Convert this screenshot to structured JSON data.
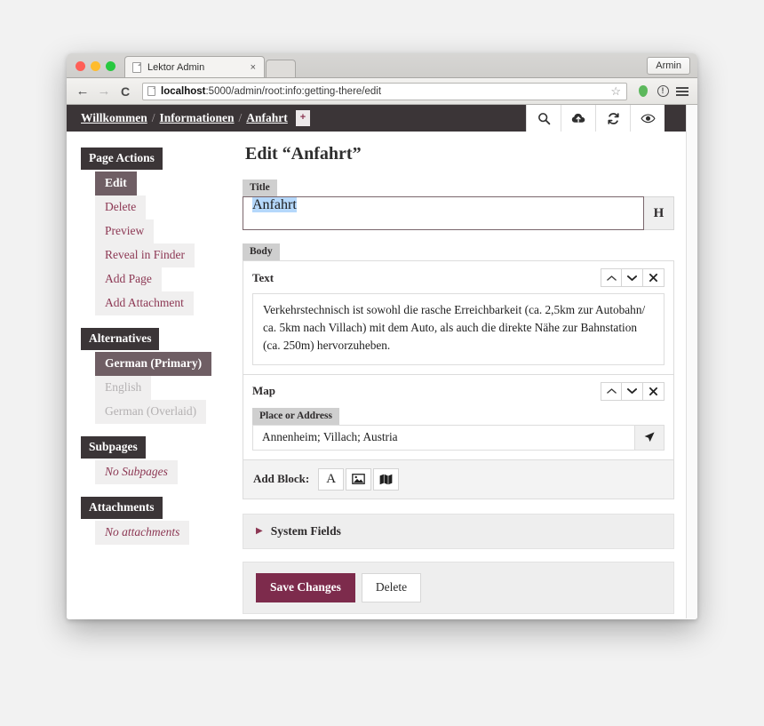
{
  "browser": {
    "tab_title": "Lektor Admin",
    "tab_close": "×",
    "profile": "Armin",
    "back_icon": "←",
    "forward_icon": "→",
    "reload_icon": "C",
    "url_prefix": "localhost",
    "url_rest": ":5000/admin/root:info:getting-there/edit",
    "star_icon": "☆"
  },
  "nav": {
    "breadcrumb": [
      {
        "label": "Willkommen"
      },
      {
        "label": "Informationen"
      },
      {
        "label": "Anfahrt"
      }
    ],
    "separator": "/",
    "add_label": "+",
    "icons": [
      "search-icon",
      "cloud-upload-icon",
      "refresh-icon",
      "eye-icon"
    ]
  },
  "sidebar": {
    "sections": [
      {
        "title": "Page Actions",
        "items": [
          {
            "label": "Edit",
            "state": "active"
          },
          {
            "label": "Delete",
            "state": "normal"
          },
          {
            "label": "Preview",
            "state": "normal"
          },
          {
            "label": "Reveal in Finder",
            "state": "normal"
          },
          {
            "label": "Add Page",
            "state": "normal"
          },
          {
            "label": "Add Attachment",
            "state": "normal"
          }
        ]
      },
      {
        "title": "Alternatives",
        "items": [
          {
            "label": "German (Primary)",
            "state": "active"
          },
          {
            "label": "English",
            "state": "disabled"
          },
          {
            "label": "German (Overlaid)",
            "state": "disabled"
          }
        ]
      },
      {
        "title": "Subpages",
        "items": [
          {
            "label": "No Subpages",
            "state": "empty"
          }
        ]
      },
      {
        "title": "Attachments",
        "items": [
          {
            "label": "No attachments",
            "state": "empty"
          }
        ]
      }
    ]
  },
  "main": {
    "page_title": "Edit “Anfahrt”",
    "title_field": {
      "label": "Title",
      "value": "Anfahrt",
      "translate_button": "H"
    },
    "body_field": {
      "label": "Body",
      "blocks": [
        {
          "title": "Text",
          "type": "text",
          "value": "Verkehrstechnisch ist sowohl die rasche Erreichbarkeit (ca. 2,5km zur Autobahn/ ca. 5km nach Villach) mit dem Auto, als auch die direkte Nähe zur Bahnstation (ca. 250m) hervorzuheben.",
          "controls": [
            "move-up",
            "move-down",
            "remove"
          ]
        },
        {
          "title": "Map",
          "type": "map",
          "sub_label": "Place or Address",
          "value": "Annenheim; Villach; Austria",
          "locate_icon": "navigate-icon",
          "controls": [
            "move-up",
            "move-down",
            "remove"
          ]
        }
      ],
      "add_block": {
        "label": "Add Block:",
        "buttons": [
          {
            "icon": "text-block-icon",
            "glyph": "A"
          },
          {
            "icon": "image-block-icon",
            "glyph": "picture"
          },
          {
            "icon": "map-block-icon",
            "glyph": "map"
          }
        ]
      }
    },
    "system_fields": {
      "label": "System Fields",
      "caret": "▶",
      "expanded": false
    },
    "actions": {
      "save_label": "Save Changes",
      "delete_label": "Delete"
    }
  },
  "colors": {
    "accent": "#8c3753",
    "primary_button": "#7d2b4c",
    "nav_bar": "#3b3537",
    "active_item": "#6f5e64",
    "selection": "#b5d8fb"
  }
}
